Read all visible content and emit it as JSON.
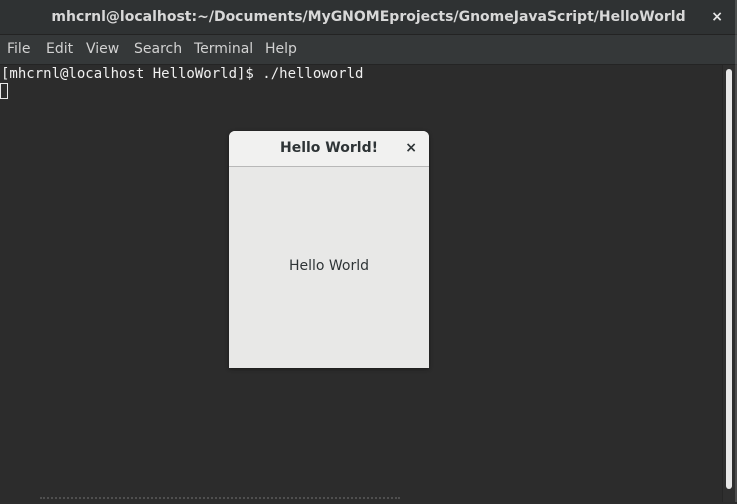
{
  "window": {
    "title": "mhcrnl@localhost:~/Documents/MyGNOMEprojects/GnomeJavaScript/HelloWorld",
    "close_icon": "×"
  },
  "menubar": {
    "items": [
      {
        "label": "File"
      },
      {
        "label": "Edit"
      },
      {
        "label": "View"
      },
      {
        "label": "Search"
      },
      {
        "label": "Terminal"
      },
      {
        "label": "Help"
      }
    ]
  },
  "terminal": {
    "prompt": "[mhcrnl@localhost HelloWorld]$ ./helloworld"
  },
  "dialog": {
    "title": "Hello World!",
    "close_icon": "×",
    "label": "Hello World"
  },
  "colors": {
    "terminal_bg": "#2c2c2c",
    "terminal_text": "#f0f0f0",
    "dialog_bg": "#e8e8e7",
    "dialog_text": "#2e3436"
  }
}
